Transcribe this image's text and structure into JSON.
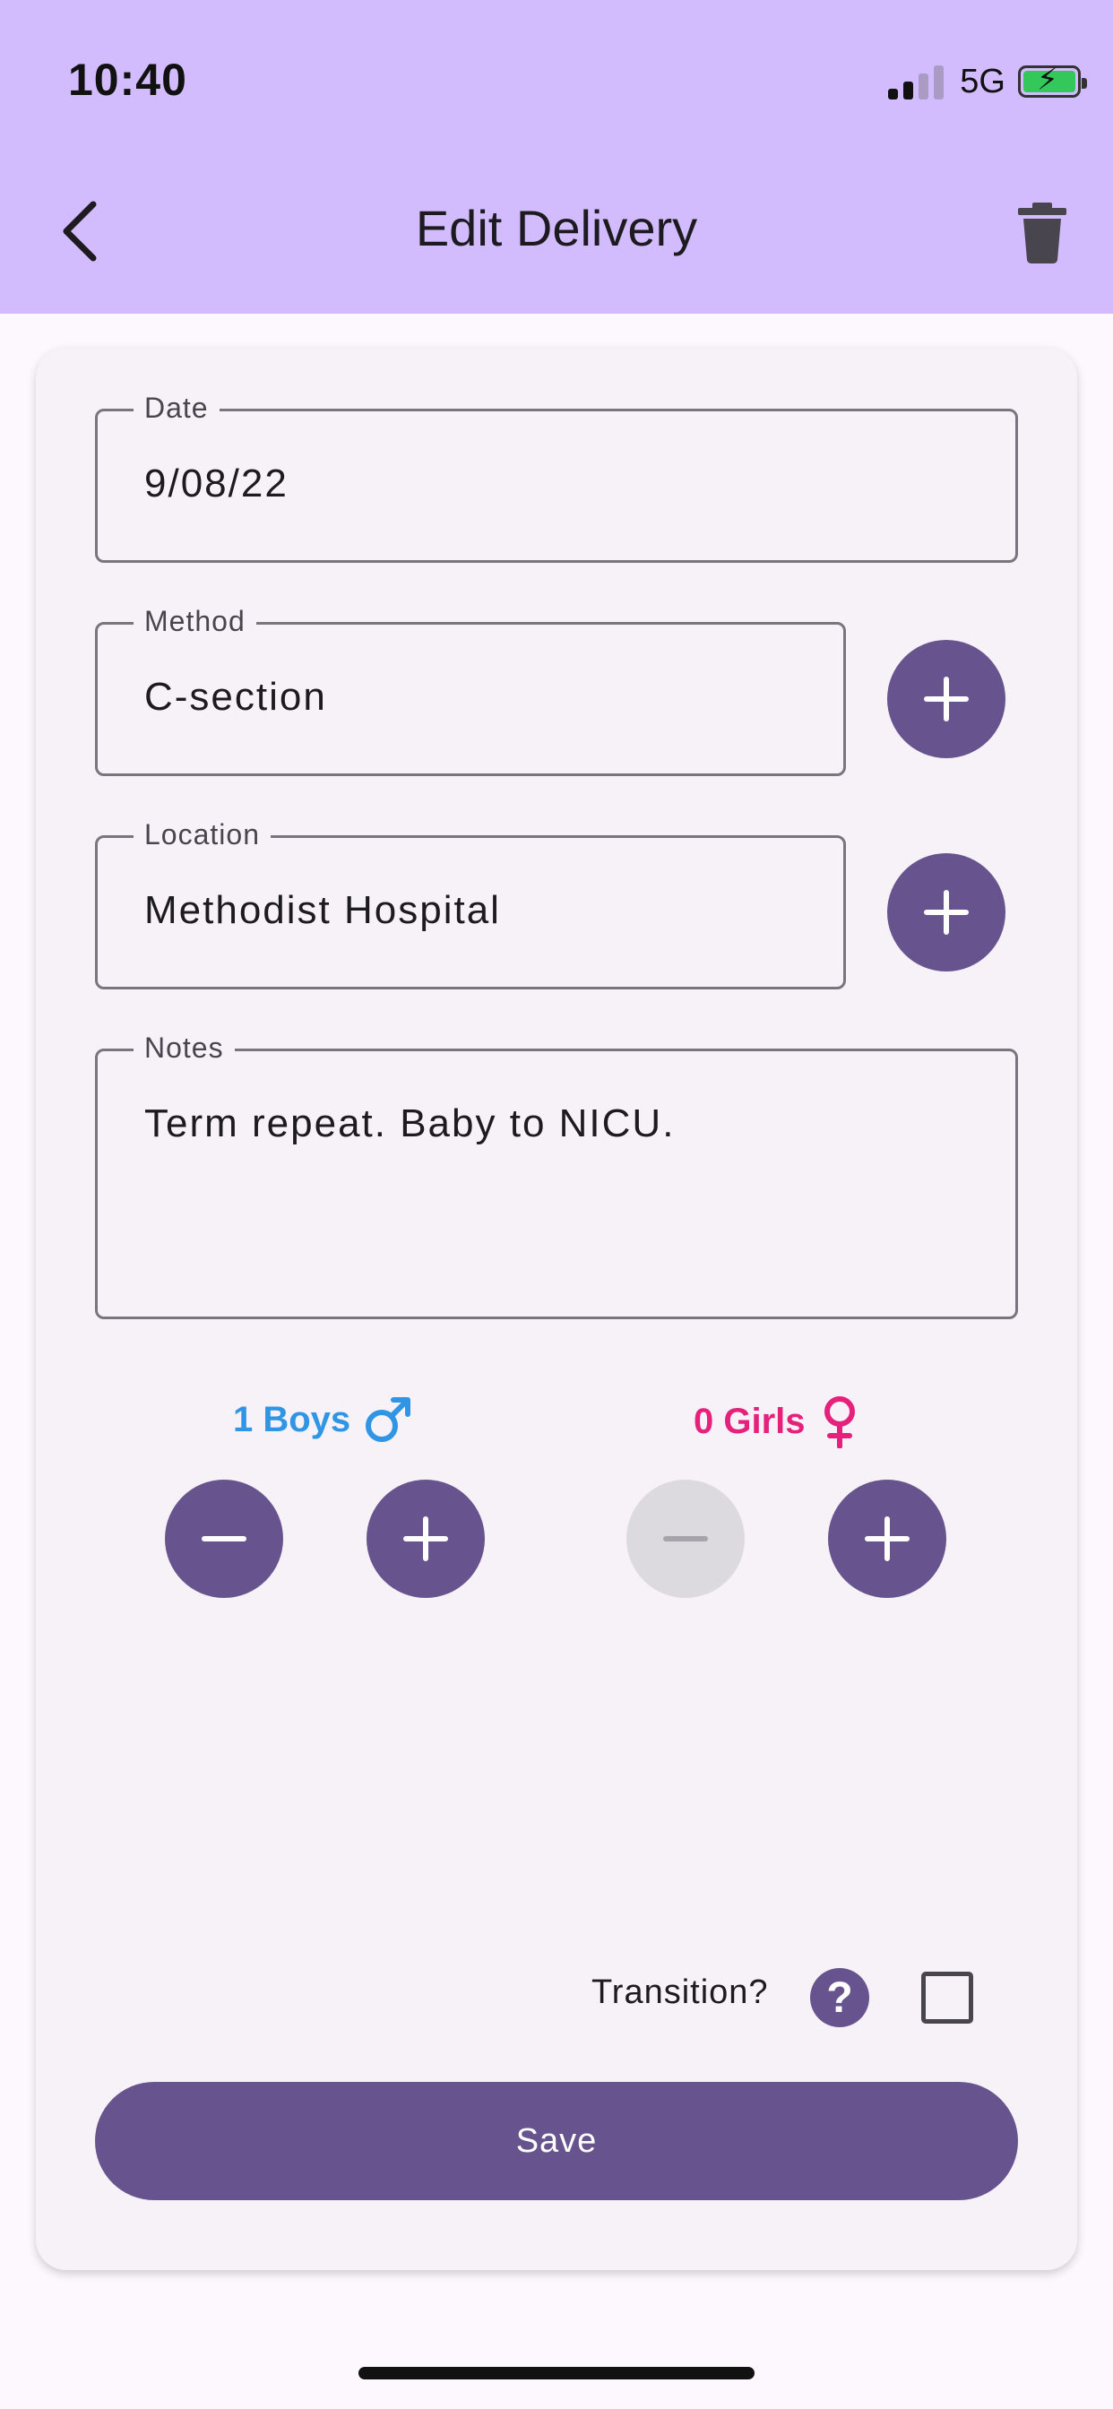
{
  "status_bar": {
    "time": "10:40",
    "network": "5G"
  },
  "app_bar": {
    "title": "Edit Delivery"
  },
  "form": {
    "date": {
      "label": "Date",
      "value": "9/08/22"
    },
    "method": {
      "label": "Method",
      "value": "C-section"
    },
    "location": {
      "label": "Location",
      "value": "Methodist Hospital"
    },
    "notes": {
      "label": "Notes",
      "value": "Term repeat. Baby to NICU."
    }
  },
  "counters": {
    "boys": {
      "label": "1 Boys",
      "count": 1,
      "color": "#2f95e4"
    },
    "girls": {
      "label": "0 Girls",
      "count": 0,
      "color": "#e5217b"
    }
  },
  "transition": {
    "label": "Transition?",
    "checked": false
  },
  "save_label": "Save",
  "colors": {
    "app_bar": "#d3bcfd",
    "accent": "#67548e",
    "background": "#fdf7fe",
    "card": "#f6f2f8"
  }
}
